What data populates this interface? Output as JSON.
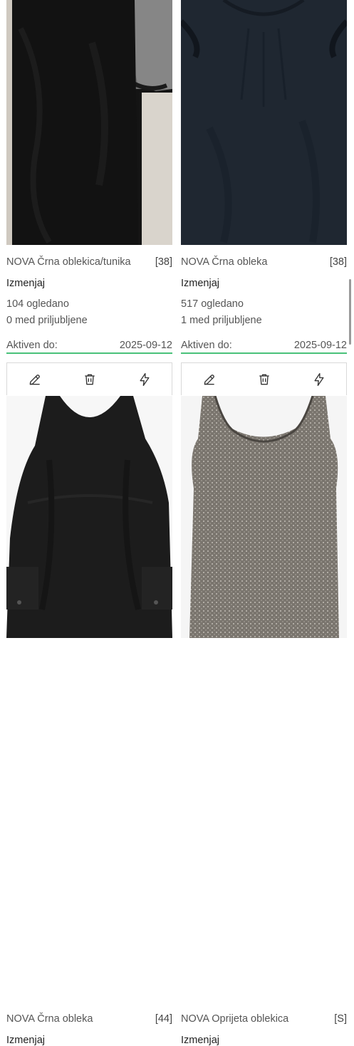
{
  "listings": [
    {
      "title": "NOVA Črna oblekica/tunika",
      "size": "[38]",
      "edit_label": "Izmenjaj",
      "views": "104 ogledano",
      "favorites": "0 med priljubljene",
      "active_label": "Aktiven do:",
      "active_date": "2025-09-12"
    },
    {
      "title": "NOVA Črna obleka",
      "size": "[38]",
      "edit_label": "Izmenjaj",
      "views": "517 ogledano",
      "favorites": "1 med priljubljene",
      "active_label": "Aktiven do:",
      "active_date": "2025-09-12"
    },
    {
      "title": "NOVA Črna obleka",
      "size": "[44]",
      "edit_label": "Izmenjaj",
      "actions": [
        "pencil-icon",
        "trash-icon",
        "lightning-icon"
      ]
    },
    {
      "title": "NOVA Oprijeta oblekica",
      "size": "[S]",
      "edit_label": "Izmenjaj",
      "actions": [
        "pencil-icon",
        "trash-icon",
        "lightning-icon"
      ]
    }
  ],
  "colors": {
    "active_underline": "#49c179",
    "text": "#555555",
    "border": "#d9d9d9"
  }
}
